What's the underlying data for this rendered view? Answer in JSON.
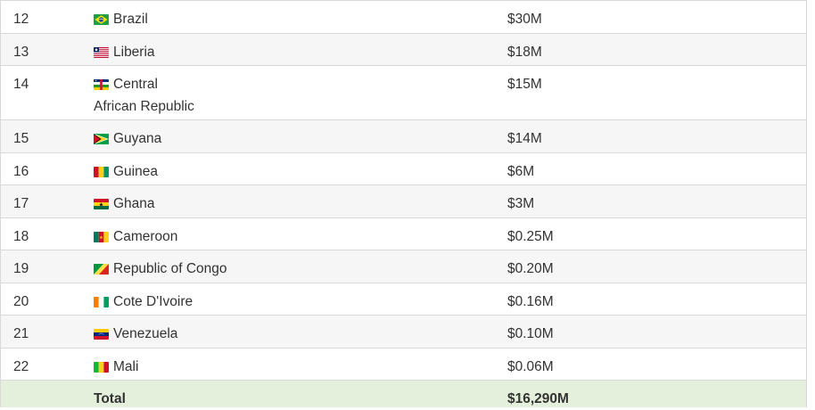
{
  "rows": [
    {
      "rank": "12",
      "country": "Brazil",
      "amount": "$30M",
      "flag_icon": "brazil-flag-icon"
    },
    {
      "rank": "13",
      "country": "Liberia",
      "amount": "$18M",
      "flag_icon": "liberia-flag-icon"
    },
    {
      "rank": "14",
      "country": "Central",
      "country_line2": "African Republic",
      "amount": "$15M",
      "flag_icon": "central-african-republic-flag-icon"
    },
    {
      "rank": "15",
      "country": "Guyana",
      "amount": "$14M",
      "flag_icon": "guyana-flag-icon"
    },
    {
      "rank": "16",
      "country": "Guinea",
      "amount": "$6M",
      "flag_icon": "guinea-flag-icon"
    },
    {
      "rank": "17",
      "country": "Ghana",
      "amount": "$3M",
      "flag_icon": "ghana-flag-icon"
    },
    {
      "rank": "18",
      "country": "Cameroon",
      "amount": "$0.25M",
      "flag_icon": "cameroon-flag-icon"
    },
    {
      "rank": "19",
      "country": "Republic of Congo",
      "amount": "$0.20M",
      "flag_icon": "republic-of-congo-flag-icon"
    },
    {
      "rank": "20",
      "country": "Cote D'Ivoire",
      "amount": "$0.16M",
      "flag_icon": "cote-divoire-flag-icon"
    },
    {
      "rank": "21",
      "country": "Venezuela",
      "amount": "$0.10M",
      "flag_icon": "venezuela-flag-icon"
    },
    {
      "rank": "22",
      "country": "Mali",
      "amount": "$0.06M",
      "flag_icon": "mali-flag-icon"
    }
  ],
  "total": {
    "label": "Total",
    "amount": "$16,290M"
  },
  "colors": {
    "border": "#d9d9d9",
    "alt_row": "#f6f6f6",
    "total_row": "#e4f0dc",
    "text": "#333333"
  }
}
